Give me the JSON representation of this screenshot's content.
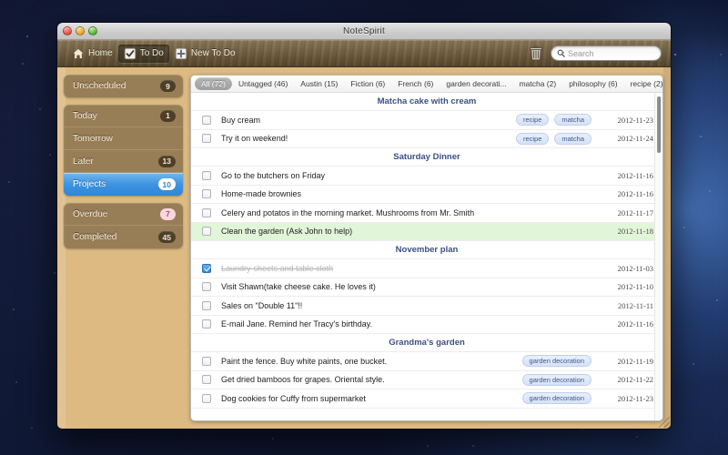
{
  "window": {
    "title": "NoteSpirit",
    "traffic_lights": [
      "close-button",
      "minimize-button",
      "zoom-button"
    ]
  },
  "toolbar": {
    "buttons": [
      {
        "label": "Home",
        "icon": "home-icon",
        "active": false
      },
      {
        "label": "To Do",
        "icon": "checkbox-icon",
        "active": true
      },
      {
        "label": "New To Do",
        "icon": "new-todo-icon",
        "active": false
      }
    ],
    "trash_icon": "trash-icon",
    "search": {
      "icon": "search-icon",
      "placeholder": "Search",
      "value": ""
    }
  },
  "sidebar": {
    "groups": [
      {
        "items": [
          {
            "label": "Unscheduled",
            "count": "9",
            "selected": false
          }
        ]
      },
      {
        "items": [
          {
            "label": "Today",
            "count": "1",
            "selected": false
          },
          {
            "label": "Tomorrow",
            "count": "",
            "selected": false
          },
          {
            "label": "Later",
            "count": "13",
            "selected": false
          },
          {
            "label": "Projects",
            "count": "10",
            "selected": true
          }
        ]
      },
      {
        "items": [
          {
            "label": "Overdue",
            "count": "7",
            "selected": false,
            "warn": true
          },
          {
            "label": "Completed",
            "count": "45",
            "selected": false
          }
        ]
      }
    ]
  },
  "tagbar": {
    "items": [
      {
        "label": "All (72)",
        "active": true
      },
      {
        "label": "Untagged (46)",
        "active": false
      },
      {
        "label": "Austin (15)",
        "active": false
      },
      {
        "label": "Fiction (6)",
        "active": false
      },
      {
        "label": "French (6)",
        "active": false
      },
      {
        "label": "garden decorati...",
        "active": false
      },
      {
        "label": "matcha (2)",
        "active": false
      },
      {
        "label": "philosophy (6)",
        "active": false
      },
      {
        "label": "recipe (2)",
        "active": false
      }
    ]
  },
  "list": {
    "groups": [
      {
        "title": "Matcha cake with cream",
        "items": [
          {
            "text": "Buy cream",
            "checked": false,
            "highlight": false,
            "tags": [
              "recipe",
              "matcha"
            ],
            "date": "2012-11-23"
          },
          {
            "text": "Try it on weekend!",
            "checked": false,
            "highlight": false,
            "tags": [
              "recipe",
              "matcha"
            ],
            "date": "2012-11-24"
          }
        ]
      },
      {
        "title": "Saturday Dinner",
        "items": [
          {
            "text": "Go to the butchers on Friday",
            "checked": false,
            "highlight": false,
            "tags": [],
            "date": "2012-11-16"
          },
          {
            "text": "Home-made brownies",
            "checked": false,
            "highlight": false,
            "tags": [],
            "date": "2012-11-16"
          },
          {
            "text": "Celery and potatos in the morning market. Mushrooms from Mr. Smith",
            "checked": false,
            "highlight": false,
            "tags": [],
            "date": "2012-11-17"
          },
          {
            "text": "Clean the garden (Ask John to help)",
            "checked": false,
            "highlight": true,
            "tags": [],
            "date": "2012-11-18"
          }
        ]
      },
      {
        "title": "November plan",
        "items": [
          {
            "text": "Laundry-sheets and table cloth",
            "checked": true,
            "highlight": false,
            "tags": [],
            "date": "2012-11-03"
          },
          {
            "text": "Visit Shawn(take cheese cake. He loves it)",
            "checked": false,
            "highlight": false,
            "tags": [],
            "date": "2012-11-10"
          },
          {
            "text": "Sales on \"Double 11\"!!",
            "checked": false,
            "highlight": false,
            "tags": [],
            "date": "2012-11-11"
          },
          {
            "text": "E-mail Jane. Remind her Tracy's birthday.",
            "checked": false,
            "highlight": false,
            "tags": [],
            "date": "2012-11-16"
          }
        ]
      },
      {
        "title": "Grandma's garden",
        "items": [
          {
            "text": "Paint the fence. Buy white paints, one bucket.",
            "checked": false,
            "highlight": false,
            "tags": [
              "garden decoration"
            ],
            "date": "2012-11-19"
          },
          {
            "text": "Get dried bamboos for grapes. Oriental style.",
            "checked": false,
            "highlight": false,
            "tags": [
              "garden decoration"
            ],
            "date": "2012-11-22"
          },
          {
            "text": "Dog cookies for Cuffy from supermarket",
            "checked": false,
            "highlight": false,
            "tags": [
              "garden decoration"
            ],
            "date": "2012-11-23"
          }
        ]
      }
    ]
  },
  "colors": {
    "selection_blue": "#2f86d9",
    "highlight_green": "#e1f5d8",
    "group_title": "#3b4f82",
    "tag_pill": "#41588f",
    "wood": "#ddba82",
    "toolbar_wood": "#6d5937"
  }
}
